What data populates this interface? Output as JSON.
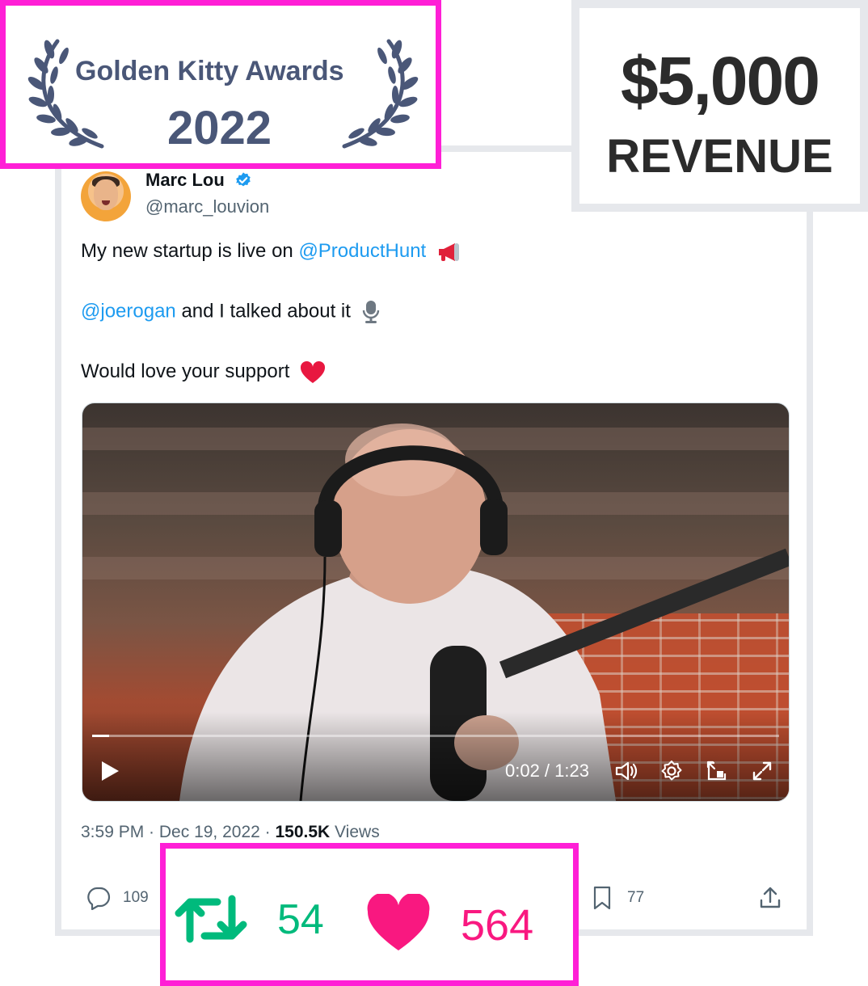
{
  "award": {
    "title": "Golden Kitty Awards",
    "year": "2022",
    "text_color": "#4a5778",
    "border_color": "#ff1fd6"
  },
  "revenue": {
    "amount": "$5,000",
    "label": "REVENUE"
  },
  "tweet": {
    "author": {
      "name": "Marc Lou",
      "handle": "@marc_louvion",
      "verified_icon": "verified-badge-icon"
    },
    "lines": {
      "l1_text": "My new startup is live on ",
      "l1_mention": "@ProductHunt",
      "l2_mention": "@joerogan",
      "l2_text": " and I talked about it",
      "l3_text": "Would love your support"
    },
    "emojis": [
      "megaphone-emoji",
      "microphone-emoji",
      "red-heart-emoji"
    ],
    "video": {
      "time": "0:02 / 1:23",
      "progress_fraction": 0.025,
      "controls": [
        "play-icon",
        "volume-icon",
        "settings-icon",
        "pip-icon",
        "fullscreen-icon"
      ]
    },
    "meta": {
      "time": "3:59 PM",
      "separator": " · ",
      "date": "Dec 19, 2022",
      "views_count": "150.5K",
      "views_label": " Views"
    },
    "actions": {
      "replies": "109",
      "bookmarks": "77"
    },
    "colors": {
      "mention": "#1d9bf0",
      "secondary_text": "#536471"
    }
  },
  "stats": {
    "retweets": "54",
    "likes": "564",
    "retweet_color": "#00ba7c",
    "like_color": "#f91880",
    "border_color": "#ff1fd6"
  }
}
